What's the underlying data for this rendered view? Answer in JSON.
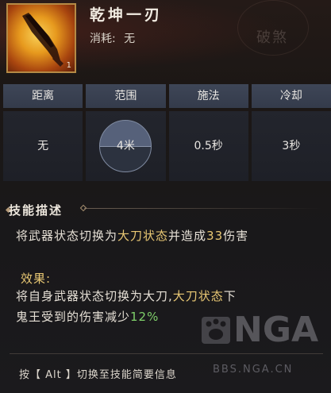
{
  "skill": {
    "title": "乾坤一刃",
    "cost_label": "消耗:",
    "cost_value": "无",
    "icon_name": "blade-skill-icon",
    "icon_level": "1",
    "side_tag": "破煞"
  },
  "stats": {
    "headers": [
      "距离",
      "范围",
      "施法",
      "冷却"
    ],
    "values": [
      "无",
      "4米",
      "0.5秒",
      "3秒"
    ]
  },
  "description": {
    "heading": "技能描述",
    "line_prefix": "将武器状态切换为",
    "line_state": "大刀状态",
    "line_mid": "并造成",
    "line_damage": "33",
    "line_suffix": "伤害",
    "effect_label": "效果:",
    "effect_line1_prefix": "将自身武器状态切换为大刀,",
    "effect_line1_state": "大刀状态",
    "effect_line1_suffix": "下",
    "effect_line2_prefix": "鬼王受到的伤害减少",
    "effect_line2_value": "12%"
  },
  "footer": {
    "hint": "按【 Alt 】切换至技能简要信息"
  },
  "watermark": {
    "brand": "NGA",
    "url": "BBS.NGA.CN"
  },
  "colors": {
    "highlight_gold": "#e9c874",
    "highlight_green": "#7fd06a",
    "header_cell": "#3e4657",
    "value_cell": "#23252d"
  }
}
